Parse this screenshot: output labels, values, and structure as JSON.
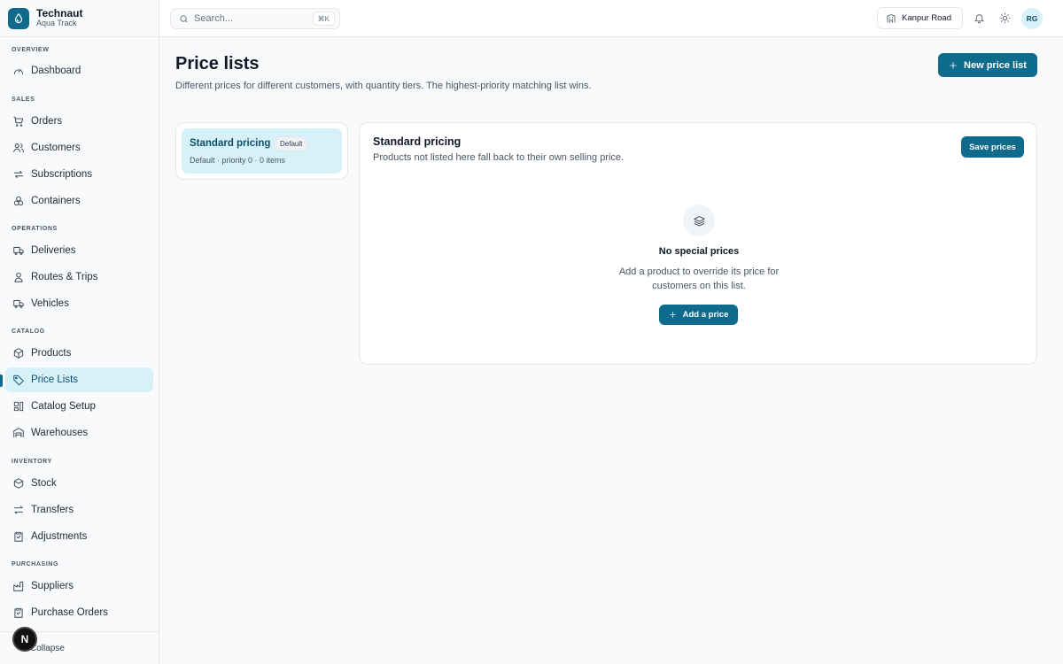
{
  "brand": {
    "name": "Technaut",
    "subtitle": "Aqua Track"
  },
  "sidebar": {
    "sections": [
      {
        "title": "Overview",
        "items": [
          {
            "label": "Dashboard",
            "icon": "gauge-icon"
          }
        ]
      },
      {
        "title": "Sales",
        "items": [
          {
            "label": "Orders",
            "icon": "cart-icon"
          },
          {
            "label": "Customers",
            "icon": "users-icon"
          },
          {
            "label": "Subscriptions",
            "icon": "repeat-icon"
          },
          {
            "label": "Containers",
            "icon": "cylinders-icon"
          }
        ]
      },
      {
        "title": "Operations",
        "items": [
          {
            "label": "Deliveries",
            "icon": "truck-icon"
          },
          {
            "label": "Routes & Trips",
            "icon": "route-icon"
          },
          {
            "label": "Vehicles",
            "icon": "vehicle-icon"
          }
        ]
      },
      {
        "title": "Catalog",
        "items": [
          {
            "label": "Products",
            "icon": "box-icon"
          },
          {
            "label": "Price Lists",
            "icon": "tag-icon",
            "active": true
          },
          {
            "label": "Catalog Setup",
            "icon": "catalog-setup-icon"
          },
          {
            "label": "Warehouses",
            "icon": "warehouse-icon"
          }
        ]
      },
      {
        "title": "Inventory",
        "items": [
          {
            "label": "Stock",
            "icon": "stock-icon"
          },
          {
            "label": "Transfers",
            "icon": "arrows-icon"
          },
          {
            "label": "Adjustments",
            "icon": "clipboard-icon"
          }
        ]
      },
      {
        "title": "Purchasing",
        "items": [
          {
            "label": "Suppliers",
            "icon": "factory-icon"
          },
          {
            "label": "Purchase Orders",
            "icon": "clipboard-check-icon"
          }
        ]
      }
    ],
    "collapse_label": "Collapse",
    "badge_letter": "N"
  },
  "topbar": {
    "search_placeholder": "Search...",
    "search_shortcut": "⌘K",
    "branch": "Kanpur Road",
    "avatar_initials": "RG"
  },
  "page": {
    "title": "Price lists",
    "description": "Different prices for different customers, with quantity tiers. The highest-priority matching list wins.",
    "new_button": "New price list"
  },
  "price_lists": [
    {
      "name": "Standard pricing",
      "badge": "Default",
      "meta": "Default · priority 0 · 0 items",
      "selected": true
    }
  ],
  "detail": {
    "title": "Standard pricing",
    "subtitle": "Products not listed here fall back to their own selling price.",
    "save_button": "Save prices",
    "empty_title": "No special prices",
    "empty_description": "Add a product to override its price for customers on this list.",
    "add_button": "Add a price"
  },
  "colors": {
    "accent": "#0e6b8c",
    "active_bg": "#d7f1f8",
    "active_text": "#0b4f6c"
  }
}
